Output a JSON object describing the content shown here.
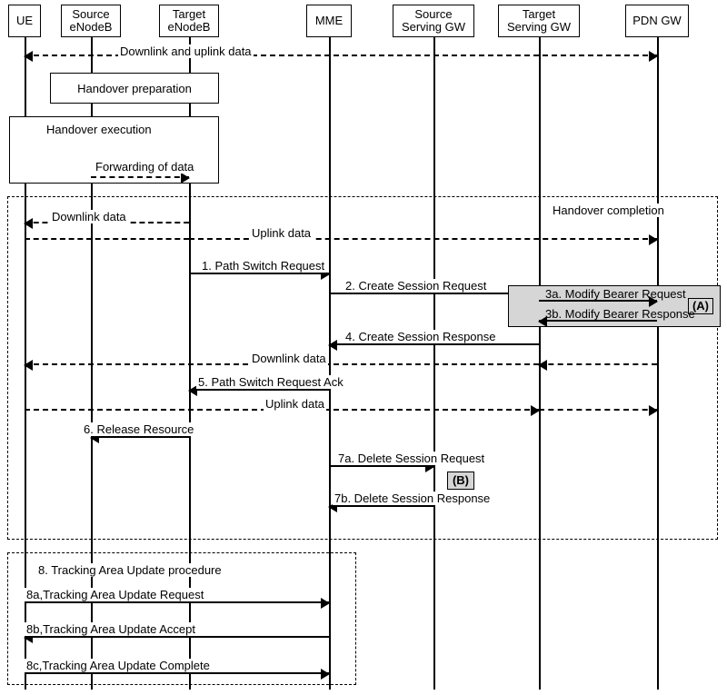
{
  "nodes": {
    "ue": "UE",
    "src_enb": "Source\neNodeB",
    "tgt_enb": "Target\neNodeB",
    "mme": "MME",
    "src_sgw": "Source\nServing GW",
    "tgt_sgw": "Target\nServing GW",
    "pdn_gw": "PDN GW"
  },
  "phase": {
    "prep": "Handover preparation",
    "exec": "Handover execution",
    "fwd": "Forwarding of data",
    "completion": "Handover completion"
  },
  "flow": {
    "dl_ul_top": "Downlink and uplink data",
    "dl_data": "Downlink data",
    "ul_data": "Uplink data",
    "dl_data2": "Downlink data",
    "ul_data2": "Uplink data"
  },
  "msg": {
    "m1": "1. Path Switch Request",
    "m2": "2. Create Session Request",
    "m3a": "3a. Modify Bearer Request",
    "m3b": "3b. Modify Bearer Response",
    "m4": "4. Create Session Response",
    "m5": "5. Path Switch Request Ack",
    "m6": "6. Release Resource",
    "m7a": "7a. Delete Session Request",
    "m7b": "7b. Delete Session Response",
    "m8": "8. Tracking Area Update procedure",
    "m8a": "8a,Tracking Area Update Request",
    "m8b": "8b,Tracking Area Update Accept",
    "m8c": "8c,Tracking Area Update Complete"
  },
  "markers": {
    "a": "(A)",
    "b": "(B)"
  }
}
